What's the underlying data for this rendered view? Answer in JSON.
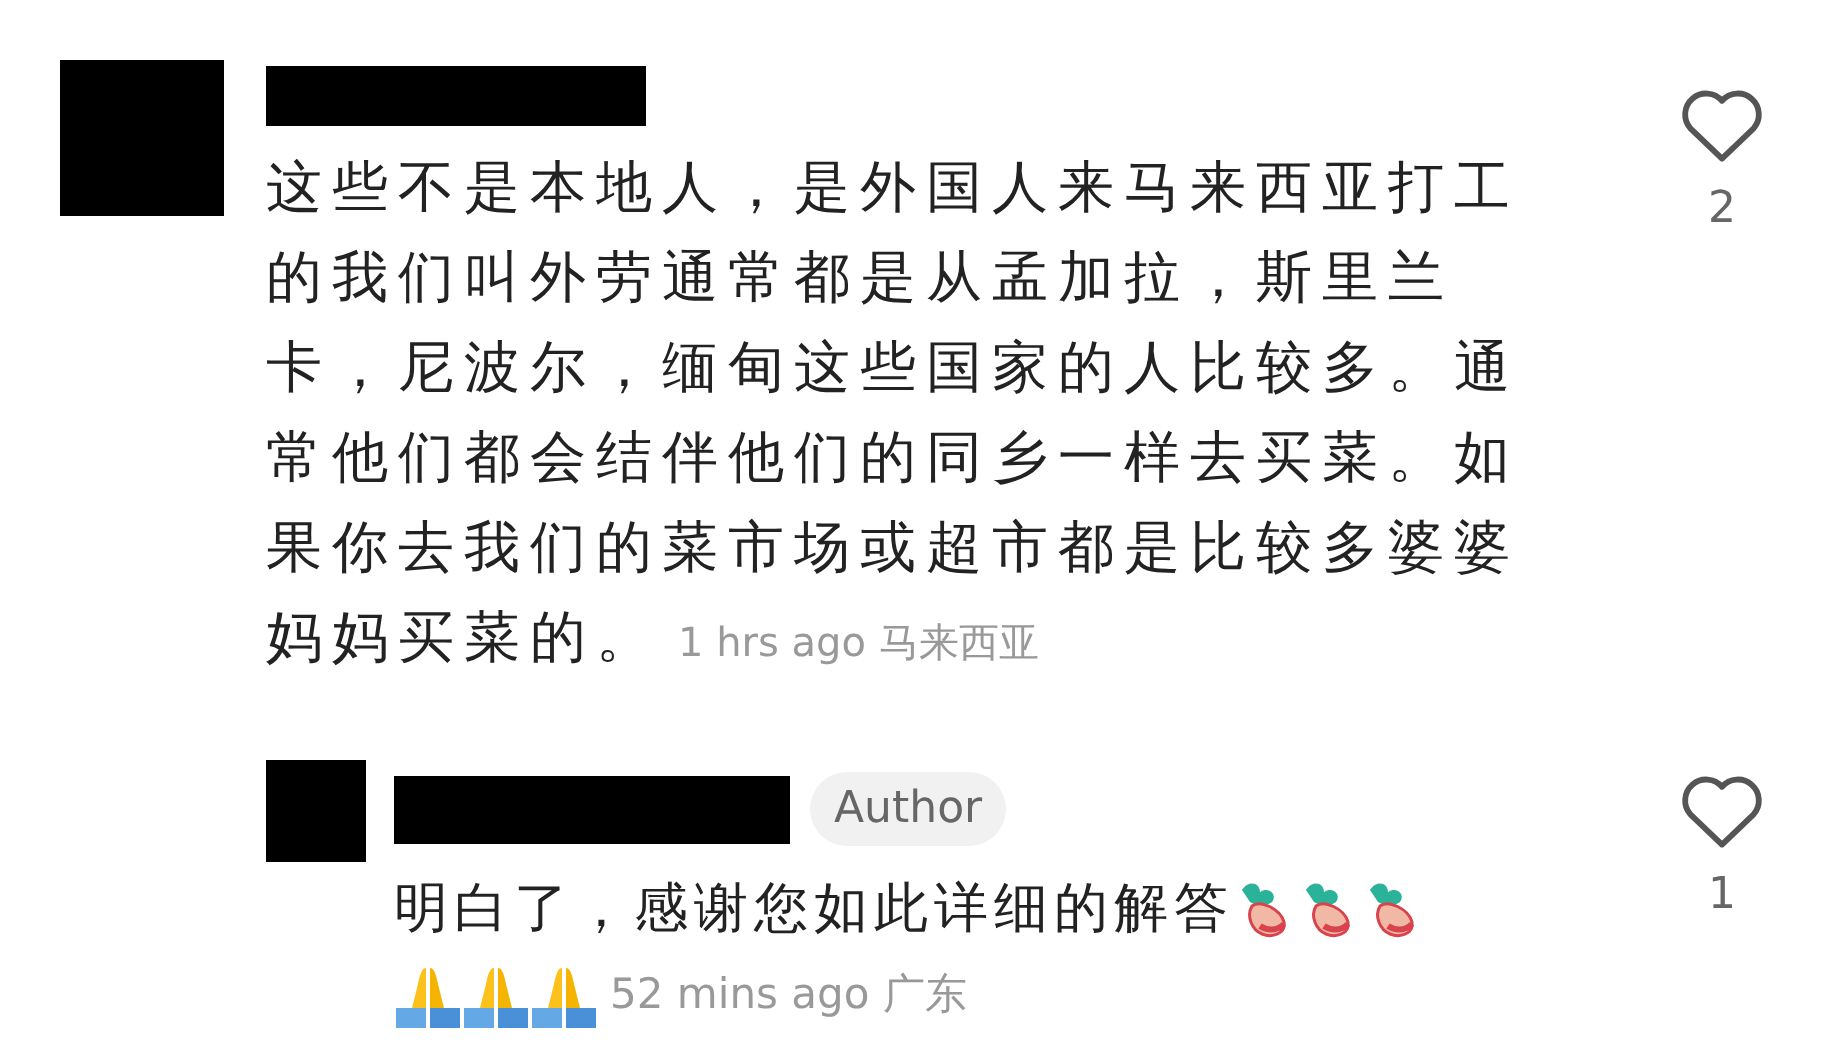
{
  "comments": [
    {
      "text": "这些不是本地人，是外国人来马来西亚打工的我们叫外劳通常都是从孟加拉，斯里兰卡，尼波尔，缅甸这些国家的人比较多。通常他们都会结伴他们的同乡一样去买菜。如果你去我们的菜市场或超市都是比较多婆婆妈妈买菜的。",
      "time": "1 hrs ago",
      "location": "马来西亚",
      "likes": "2",
      "replies": [
        {
          "badge": "Author",
          "text": "明白了，感谢您如此详细的解答",
          "time": "52 mins ago",
          "location": "广东",
          "likes": "1"
        }
      ]
    }
  ]
}
